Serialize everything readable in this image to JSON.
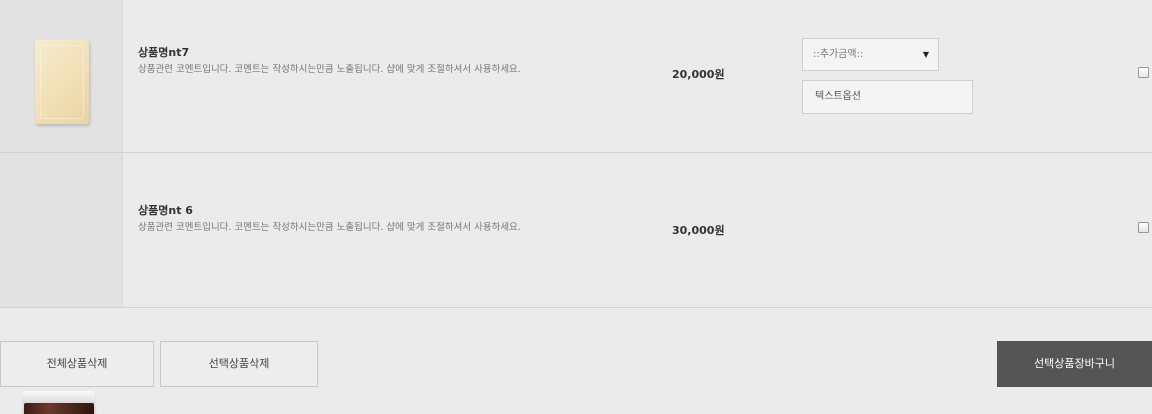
{
  "products": [
    {
      "name": "상품명nt7",
      "description": "상품관련 코멘트입니다. 코멘트는 작성하시는만큼 노출됩니다. 샵에 맞게 조절하셔서 사용하세요.",
      "price": "20,000원",
      "image_icon": "soap-bar-image",
      "option_select": "::추가금액::",
      "option_text": "텍스트옵션",
      "checked": false
    },
    {
      "name": "상품명nt 6",
      "description": "상품관련 코멘트입니다. 코멘트는 작성하시는만큼 노출됩니다. 샵에 맞게 조절하셔서 사용하세요.",
      "price": "30,000원",
      "image_icon": "cream-jar-image",
      "checked": false
    }
  ],
  "actions": {
    "delete_all": "전체상품삭제",
    "delete_selected": "선택상품삭제",
    "add_selected_to_cart": "선택상품장바구니"
  },
  "colors": {
    "background": "#ebebeb",
    "dark_button": "#555555"
  }
}
